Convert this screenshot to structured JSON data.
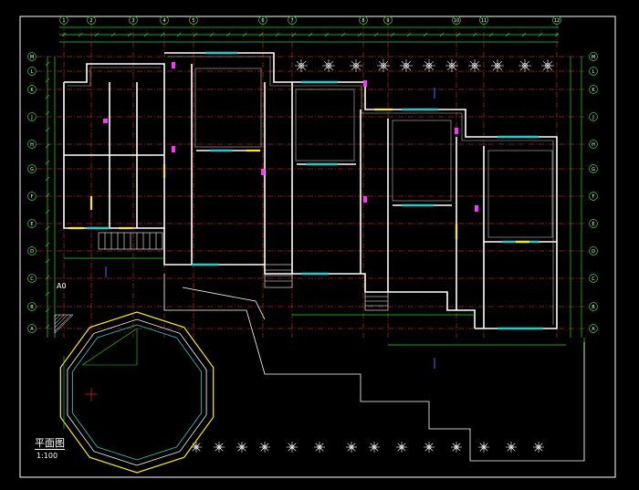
{
  "drawing": {
    "title": "平面图",
    "scale": "1:100",
    "section_mark": "A0"
  },
  "colors": {
    "background": "#000000",
    "frame": "#ffffff",
    "axis": "#ff3030",
    "wall": "#ffffff",
    "dimension": "#22dd22",
    "window": "#22cccc",
    "door": "#ffee00",
    "text": "#ffffff",
    "accent": "#ff33ff",
    "annotation": "#4a6cff"
  },
  "axes": {
    "columns": [
      "1",
      "2",
      "3",
      "4",
      "5",
      "6",
      "7",
      "8",
      "9",
      "10",
      "11",
      "12"
    ],
    "rows": [
      "A",
      "B",
      "C",
      "D",
      "E",
      "F",
      "G",
      "H",
      "J",
      "K",
      "L",
      "M"
    ]
  }
}
